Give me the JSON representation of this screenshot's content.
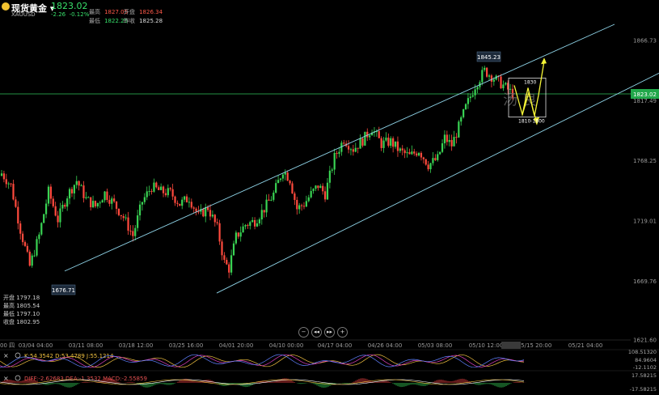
{
  "header": {
    "title": "现货黄金",
    "symbol": "XAUUSD",
    "price": "1823.02",
    "change": "-2.26",
    "change_pct": "-0.12%",
    "high_label": "最高",
    "high": "1827.05",
    "open_label": "开盘",
    "open": "1826.34",
    "low_label": "最低",
    "low": "1822.25",
    "prev_close_label": "昨收",
    "prev_close": "1825.28"
  },
  "ohlc_panel": {
    "open": "开盘 1797.18",
    "high": "最高 1805.54",
    "low": "最低 1797.10",
    "close": "收盘 1802.95"
  },
  "annotations": {
    "low_label": "1676.71",
    "high_label": "1845.23",
    "target_up": "1830",
    "target_down": "1810-1800",
    "watermark": "汤 良"
  },
  "controls": [
    "−",
    "◂◂",
    "▸▸",
    "+"
  ],
  "indicators": {
    "kdj_text": "K:54.3542  D:53.4789  J:55.1214",
    "macd_text": "DIFF:-2.62683  DEA:-1.3532  MACD:-2.55859",
    "kdj_axis": [
      "108.51320",
      "84.9604",
      "-12.1102"
    ],
    "macd_axis": [
      "17.58215",
      "-17.58215"
    ]
  },
  "chart_data": {
    "type": "candlestick",
    "x_tick_labels": [
      "00 四",
      "03/04 04:00",
      "03/11 08:00",
      "03/18 12:00",
      "03/25 16:00",
      "04/01 20:00",
      "04/10 00:00",
      "04/17 04:00",
      "04/26 04:00",
      "05/03 08:00",
      "05/10 12:00",
      "05/15 20:00",
      "05/21 04:00"
    ],
    "y_tick_labels": [
      "1866.73",
      "1817.49",
      "1768.25",
      "1719.01",
      "1669.76",
      "1621.60"
    ],
    "ylim": [
      1621.6,
      1880
    ],
    "current_price": 1823.02,
    "trend_channel": "ascending",
    "projection": "up to 1830, down to 1810-1800",
    "waypoints": [
      [
        0,
        1758
      ],
      [
        4,
        1748
      ],
      [
        8,
        1712
      ],
      [
        12,
        1682
      ],
      [
        16,
        1707
      ],
      [
        20,
        1743
      ],
      [
        24,
        1720
      ],
      [
        28,
        1740
      ],
      [
        32,
        1752
      ],
      [
        36,
        1737
      ],
      [
        40,
        1731
      ],
      [
        44,
        1742
      ],
      [
        48,
        1733
      ],
      [
        52,
        1722
      ],
      [
        56,
        1707
      ],
      [
        60,
        1735
      ],
      [
        64,
        1747
      ],
      [
        68,
        1743
      ],
      [
        72,
        1742
      ],
      [
        76,
        1733
      ],
      [
        80,
        1738
      ],
      [
        84,
        1723
      ],
      [
        88,
        1730
      ],
      [
        92,
        1713
      ],
      [
        95,
        1685
      ],
      [
        97,
        1680
      ],
      [
        100,
        1706
      ],
      [
        104,
        1716
      ],
      [
        108,
        1719
      ],
      [
        112,
        1729
      ],
      [
        116,
        1741
      ],
      [
        120,
        1761
      ],
      [
        123,
        1753
      ],
      [
        126,
        1729
      ],
      [
        129,
        1733
      ],
      [
        132,
        1741
      ],
      [
        135,
        1748
      ],
      [
        138,
        1741
      ],
      [
        142,
        1771
      ],
      [
        146,
        1786
      ],
      [
        150,
        1778
      ],
      [
        154,
        1785
      ],
      [
        158,
        1795
      ],
      [
        162,
        1782
      ],
      [
        166,
        1784
      ],
      [
        170,
        1776
      ],
      [
        174,
        1772
      ],
      [
        178,
        1777
      ],
      [
        182,
        1765
      ],
      [
        186,
        1770
      ],
      [
        189,
        1787
      ],
      [
        192,
        1781
      ],
      [
        195,
        1796
      ],
      [
        198,
        1812
      ],
      [
        202,
        1830
      ],
      [
        206,
        1842
      ],
      [
        210,
        1836
      ],
      [
        214,
        1830
      ],
      [
        218,
        1823
      ]
    ]
  }
}
